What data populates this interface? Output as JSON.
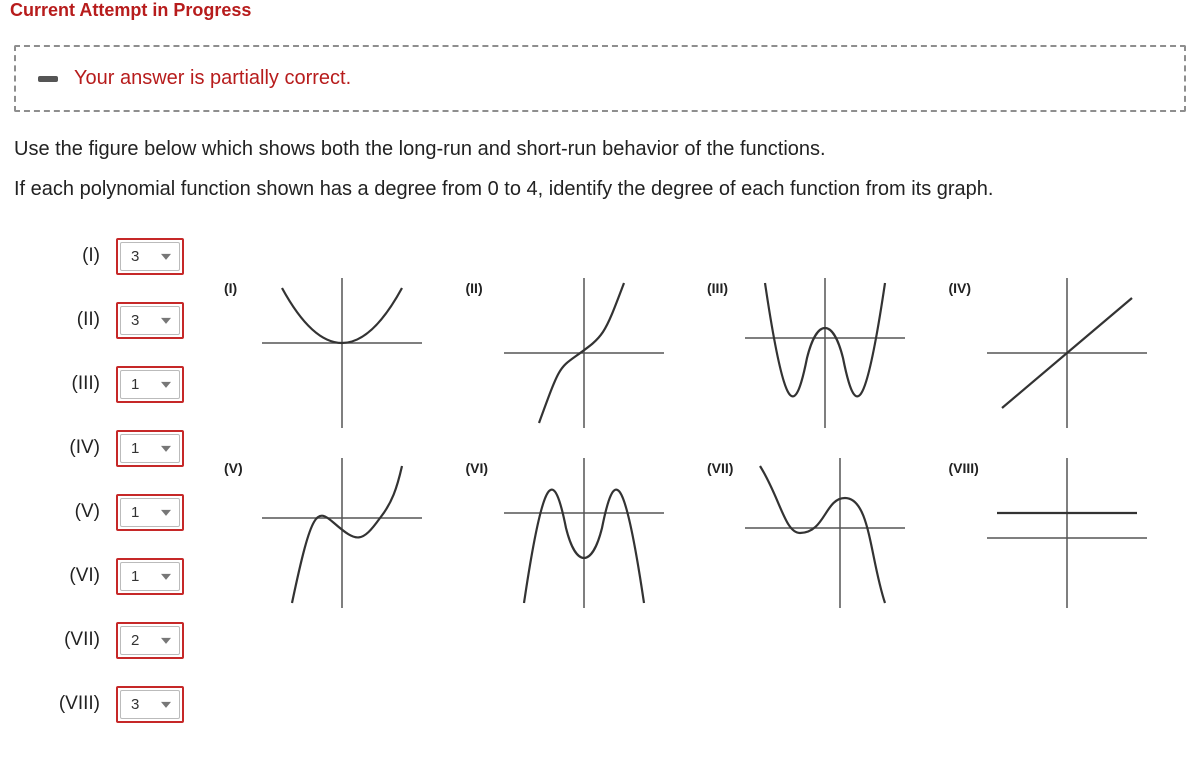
{
  "header": {
    "title": "Current Attempt in Progress"
  },
  "feedback": {
    "message": "Your answer is partially correct."
  },
  "prompt": {
    "line1": "Use the figure below which shows both the long-run and short-run behavior of the functions.",
    "line2": "If each polynomial function shown has a degree from 0 to 4, identify the degree of each function from its graph."
  },
  "answers": [
    {
      "label": "(I)",
      "value": "3"
    },
    {
      "label": "(II)",
      "value": "3"
    },
    {
      "label": "(III)",
      "value": "1"
    },
    {
      "label": "(IV)",
      "value": "1"
    },
    {
      "label": "(V)",
      "value": "1"
    },
    {
      "label": "(VI)",
      "value": "1"
    },
    {
      "label": "(VII)",
      "value": "2"
    },
    {
      "label": "(VIII)",
      "value": "3"
    }
  ],
  "graphs": [
    {
      "label": "(I)"
    },
    {
      "label": "(II)"
    },
    {
      "label": "(III)"
    },
    {
      "label": "(IV)"
    },
    {
      "label": "(V)"
    },
    {
      "label": "(VI)"
    },
    {
      "label": "(VII)"
    },
    {
      "label": "(VIII)"
    }
  ]
}
